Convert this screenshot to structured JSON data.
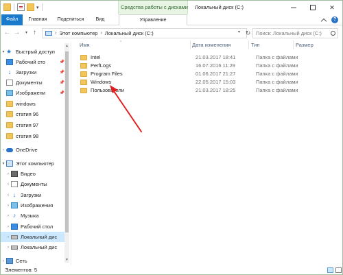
{
  "window": {
    "context_tab_title": "Средства работы с дисками",
    "title": "Локальный диск (C:)"
  },
  "ribbon": {
    "tabs": [
      "Файл",
      "Главная",
      "Поделиться",
      "Вид",
      "Управление"
    ]
  },
  "address": {
    "segments": [
      "Этот компьютер",
      "Локальный диск (C:)"
    ],
    "search_placeholder": "Поиск: Локальный диск (C:)"
  },
  "nav": {
    "quick_access": "Быстрый доступ",
    "pinned": [
      "Рабочий сто",
      "Загрузки",
      "Документы",
      "Изображени"
    ],
    "recent": [
      "windows",
      "статия 96",
      "статия 97",
      "статия 98"
    ],
    "onedrive": "OneDrive",
    "this_pc": "Этот компьютер",
    "pc_items": [
      "Видео",
      "Документы",
      "Загрузки",
      "Изображения",
      "Музыка",
      "Рабочий стол",
      "Локальный дис",
      "Локальный дис"
    ],
    "network": "Сеть"
  },
  "columns": {
    "name": "Имя",
    "date": "Дата изменения",
    "type": "Тип",
    "size": "Размер"
  },
  "files": [
    {
      "name": "Intel",
      "date": "21.03.2017 18:41",
      "type": "Папка с файлами"
    },
    {
      "name": "PerfLogs",
      "date": "16.07.2016 11:29",
      "type": "Папка с файлами"
    },
    {
      "name": "Program Files",
      "date": "01.06.2017 21:27",
      "type": "Папка с файлами"
    },
    {
      "name": "Windows",
      "date": "22.05.2017 15:03",
      "type": "Папка с файлами"
    },
    {
      "name": "Пользователи",
      "date": "21.03.2017 18:25",
      "type": "Папка с файлами"
    }
  ],
  "status": {
    "items_count": "Элементов: 5"
  },
  "colors": {
    "file_tab": "#1979ca",
    "context_tab": "#e9f5e4",
    "selection": "#cce8ff",
    "folder": "#f3c65a",
    "annotation_arrow": "#e02020"
  },
  "icons": {
    "nav_back": "arrow-left-icon",
    "nav_forward": "arrow-right-icon",
    "nav_up": "arrow-up-icon",
    "refresh": "refresh-icon",
    "search": "search-icon"
  }
}
